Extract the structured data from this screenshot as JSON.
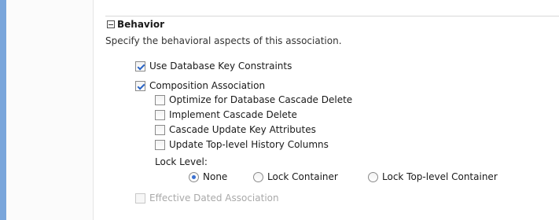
{
  "section": {
    "title": "Behavior",
    "description": "Specify the behavioral aspects of this association."
  },
  "checkboxes": {
    "use_db_key_constraints": {
      "label": "Use Database Key Constraints",
      "checked": true
    },
    "composition_association": {
      "label": "Composition Association",
      "checked": true
    },
    "optimize_cascade_delete": {
      "label": "Optimize for Database Cascade Delete",
      "checked": false
    },
    "implement_cascade_delete": {
      "label": "Implement Cascade Delete",
      "checked": false
    },
    "cascade_update_key_attrs": {
      "label": "Cascade Update Key Attributes",
      "checked": false
    },
    "update_history_columns": {
      "label": "Update Top-level History Columns",
      "checked": false
    },
    "effective_dated_association": {
      "label": "Effective Dated Association",
      "checked": false,
      "disabled": true
    }
  },
  "lock_level": {
    "label": "Lock Level:",
    "options": [
      {
        "label": "None",
        "selected": true
      },
      {
        "label": "Lock Container",
        "selected": false
      },
      {
        "label": "Lock Top-level Container",
        "selected": false
      }
    ]
  },
  "colors": {
    "left_accent": "#7aa6db",
    "check_mark": "#2a64c5",
    "disabled_text": "#a9a9a9"
  }
}
